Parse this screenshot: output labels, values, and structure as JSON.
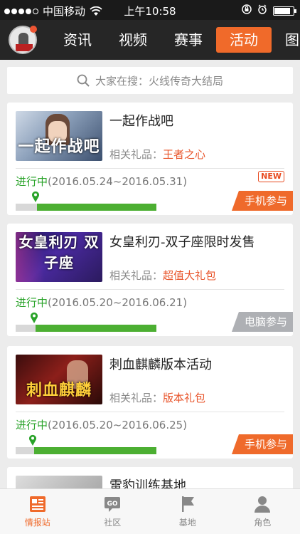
{
  "status_bar": {
    "carrier": "中国移动",
    "time": "上午10:58"
  },
  "nav": {
    "tabs": [
      {
        "label": "资讯",
        "active": false
      },
      {
        "label": "视频",
        "active": false
      },
      {
        "label": "赛事",
        "active": false
      },
      {
        "label": "活动",
        "active": true
      },
      {
        "label": "图",
        "active": false
      }
    ]
  },
  "search": {
    "placeholder": "大家在搜：火线传奇大结局"
  },
  "gift_prefix": "相关礼品：",
  "activities": [
    {
      "title": "一起作战吧",
      "image_caption": "一起作战吧",
      "gift": "王者之心",
      "status": "进行中",
      "date_range": "(2016.05.24~2016.05.31)",
      "badge": "NEW",
      "platform": "手机参与",
      "progress": 0.85
    },
    {
      "title": "女皇利刃-双子座限时发售",
      "image_caption": "女皇利刃 双子座",
      "gift": "超值大礼包",
      "status": "进行中",
      "date_range": "(2016.05.20~2016.06.21)",
      "badge": "",
      "platform": "电脑参与",
      "progress": 0.86
    },
    {
      "title": "刺血麒麟版本活动",
      "image_caption": "刺血麒麟",
      "gift": "版本礼包",
      "status": "进行中",
      "date_range": "(2016.05.20~2016.06.25)",
      "badge": "",
      "platform": "手机参与",
      "progress": 0.87
    },
    {
      "title": "雷豹训练基地",
      "image_caption": "",
      "gift": "",
      "status": "",
      "date_range": "",
      "badge": "",
      "platform": "",
      "progress": 0
    }
  ],
  "tabbar": [
    {
      "label": "情报站",
      "icon": "newspaper-icon",
      "active": true
    },
    {
      "label": "社区",
      "icon": "community-chat-icon",
      "active": false
    },
    {
      "label": "基地",
      "icon": "flag-icon",
      "active": false
    },
    {
      "label": "角色",
      "icon": "person-icon",
      "active": false
    }
  ],
  "colors": {
    "accent": "#ef6a2b",
    "green": "#29a329",
    "nav_bg": "#262626",
    "pc_badge": "#aeb0b4"
  }
}
